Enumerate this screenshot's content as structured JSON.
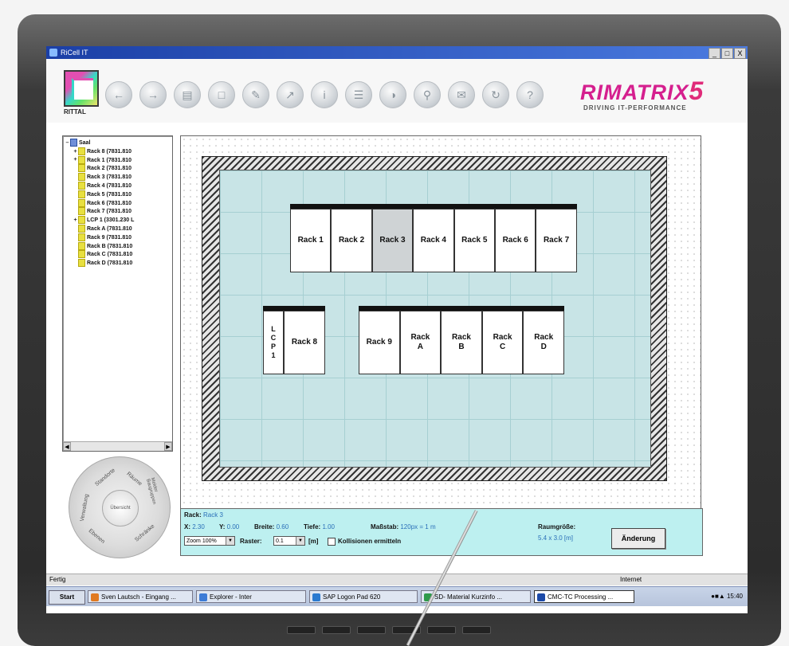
{
  "window": {
    "title": "RiCell IT",
    "controls": [
      "_",
      "□",
      "X"
    ]
  },
  "toolbar": {
    "logo_text": "RITTAL",
    "buttons": [
      "back-icon",
      "forward-icon",
      "save-icon",
      "open-icon",
      "edit-icon",
      "export-icon",
      "info-icon",
      "notes-icon",
      "globe-icon",
      "search-icon",
      "mail-icon",
      "refresh-icon",
      "help-icon"
    ]
  },
  "brand": {
    "name": "RIMATRIX",
    "suffix": "5",
    "tagline": "DRIVING IT-PERFORMANCE"
  },
  "tree": {
    "items": [
      {
        "label": "Saal",
        "expander": "–",
        "root": true
      },
      {
        "label": "Rack 8 (7831.810",
        "expander": "+"
      },
      {
        "label": "Rack 1 (7831.810",
        "expander": "+"
      },
      {
        "label": "Rack 2 (7831.810",
        "expander": ""
      },
      {
        "label": "Rack 3 (7831.810",
        "expander": ""
      },
      {
        "label": "Rack 4 (7831.810",
        "expander": ""
      },
      {
        "label": "Rack 5 (7831.810",
        "expander": ""
      },
      {
        "label": "Rack 6 (7831.810",
        "expander": ""
      },
      {
        "label": "Rack 7 (7831.810",
        "expander": ""
      },
      {
        "label": "LCP 1 (3301.230 L",
        "expander": "+"
      },
      {
        "label": "Rack A (7831.810",
        "expander": ""
      },
      {
        "label": "Rack 9 (7831.810",
        "expander": ""
      },
      {
        "label": "Rack B (7831.810",
        "expander": ""
      },
      {
        "label": "Rack C (7831.810",
        "expander": ""
      },
      {
        "label": "Rack D (7831.810",
        "expander": ""
      }
    ]
  },
  "nav_wheel": {
    "center": "Übersicht",
    "segments": [
      "Standorte",
      "Räume",
      "Verwaltung",
      "Ebenen",
      "Melder Baugruppen",
      "Schränke"
    ]
  },
  "layout": {
    "racks_top": [
      "Rack 1",
      "Rack 2",
      "Rack 3",
      "Rack 4",
      "Rack 5",
      "Rack 6",
      "Rack 7"
    ],
    "selected_rack": "Rack 3",
    "lcp_label": "L\nC\nP\n1",
    "rack_8": "Rack 8",
    "racks_bottom": [
      "Rack 9",
      "Rack\nA",
      "Rack\nB",
      "Rack\nC",
      "Rack\nD"
    ]
  },
  "status": {
    "rack_label": "Rack:",
    "rack_value": "Rack 3",
    "x_label": "X:",
    "x_value": "2.30",
    "y_label": "Y:",
    "y_value": "0.00",
    "breite_label": "Breite:",
    "breite_value": "0.60",
    "tiefe_label": "Tiefe:",
    "tiefe_value": "1.00",
    "massstab_label": "Maßstab:",
    "massstab_value": "120px = 1 m",
    "raumgroesse_label": "Raumgröße:",
    "raumgroesse_value": "5.4 x 3.0 [m]",
    "zoom_value": "Zoom 100%",
    "raster_label": "Raster:",
    "raster_value": "0.1",
    "unit": "[m]",
    "kollision_label": "Kollisionen ermitteln",
    "aenderung_button": "Änderung"
  },
  "ie_status": {
    "left": "Fertig",
    "right": "Internet"
  },
  "taskbar": {
    "start": "Start",
    "tasks": [
      {
        "label": "Sven Lautsch - Eingang ...",
        "color": "#e07a22"
      },
      {
        "label": "Explorer - Inter",
        "color": "#3c7bd6"
      },
      {
        "label": "SAP Logon Pad 620",
        "color": "#2a7ad0"
      },
      {
        "label": "SD- Material Kurzinfo ...",
        "color": "#2f9a4a"
      },
      {
        "label": "CMC-TC Processing ...",
        "color": "#1c4aa8"
      }
    ],
    "clock": "15:40"
  }
}
